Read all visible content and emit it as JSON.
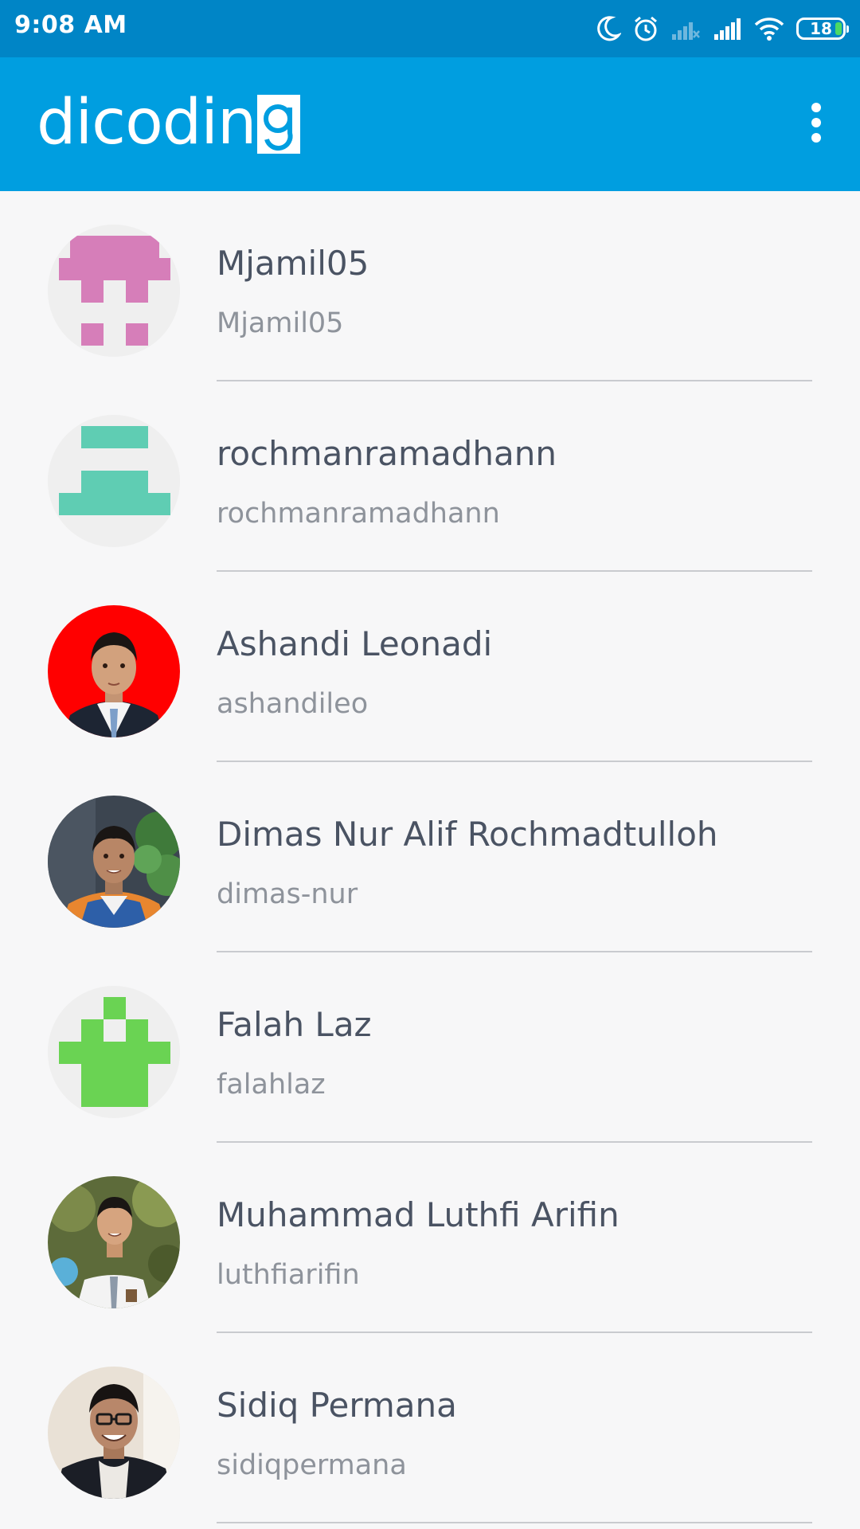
{
  "status_bar": {
    "time": "9:08 AM",
    "battery_level": "18",
    "icons": [
      "moon-icon",
      "alarm-icon",
      "signal-sim1-icon",
      "signal-sim2-icon",
      "wifi-icon",
      "battery-icon"
    ]
  },
  "app_bar": {
    "logo_text": "dicodin",
    "logo_box_letter": "g",
    "menu_icon": "overflow-menu-icon",
    "background": "#009ee0"
  },
  "users": [
    {
      "name": "Mjamil05",
      "login": "Mjamil05",
      "avatar": "identicon-pink"
    },
    {
      "name": "rochmanramadhann",
      "login": "rochmanramadhann",
      "avatar": "identicon-teal"
    },
    {
      "name": "Ashandi Leonadi",
      "login": "ashandileo",
      "avatar": "photo-portrait-red-background"
    },
    {
      "name": "Dimas Nur Alif Rochmadtulloh",
      "login": "dimas-nur",
      "avatar": "photo-portrait-outdoor"
    },
    {
      "name": "Falah Laz",
      "login": "falahlaz",
      "avatar": "identicon-green"
    },
    {
      "name": "Muhammad Luthfi Arifin",
      "login": "luthfiarifin",
      "avatar": "photo-portrait-school-uniform"
    },
    {
      "name": "Sidiq Permana",
      "login": "sidiqpermana",
      "avatar": "photo-portrait-glasses"
    }
  ],
  "colors": {
    "status_bar": "#0085c6",
    "accent": "#009ee0",
    "name_text": "#4a5363",
    "login_text": "#8e939b",
    "identicon_pink": "#d67eb9",
    "identicon_teal": "#5fcdb3",
    "identicon_green": "#6ad353"
  }
}
